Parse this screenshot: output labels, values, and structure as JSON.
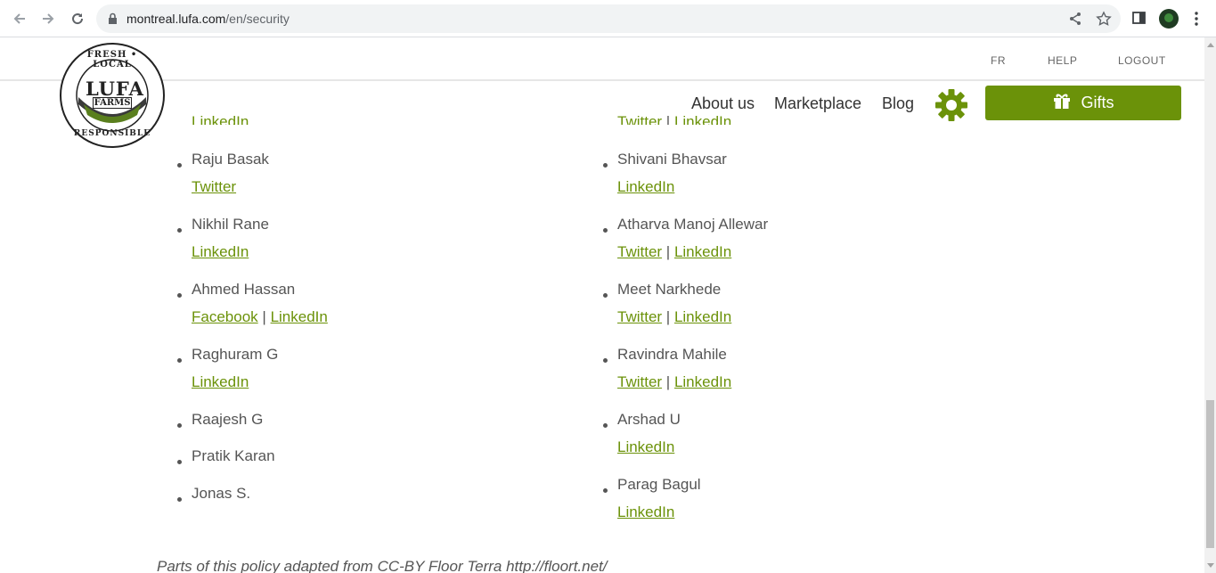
{
  "browser": {
    "url_host": "montreal.lufa.com",
    "url_path": "/en/security"
  },
  "header": {
    "util_links": [
      "FR",
      "HELP",
      "LOGOUT"
    ],
    "nav": [
      "About us",
      "Marketplace",
      "Blog"
    ],
    "gifts_label": "Gifts",
    "logo_text": {
      "top": "FRESH • LOCAL",
      "middle": "LUFA",
      "sub": "FARMS",
      "bottom": "RESPONSIBLE"
    }
  },
  "partial_links": {
    "left": "LinkedIn",
    "right_a": "Twitter",
    "right_sep": "|",
    "right_b": "LinkedIn"
  },
  "left_column": [
    {
      "name": "Raju Basak",
      "links": [
        "Twitter"
      ]
    },
    {
      "name": "Nikhil Rane",
      "links": [
        "LinkedIn"
      ]
    },
    {
      "name": "Ahmed Hassan",
      "links": [
        "Facebook",
        "LinkedIn"
      ]
    },
    {
      "name": "Raghuram G",
      "links": [
        "LinkedIn"
      ]
    },
    {
      "name": "Raajesh G",
      "links": []
    },
    {
      "name": "Pratik Karan",
      "links": []
    },
    {
      "name": "Jonas S.",
      "links": []
    }
  ],
  "right_column": [
    {
      "name": "Shivani Bhavsar",
      "links": [
        "LinkedIn"
      ]
    },
    {
      "name": "Atharva Manoj Allewar",
      "links": [
        "Twitter",
        "LinkedIn"
      ]
    },
    {
      "name": "Meet Narkhede",
      "links": [
        "Twitter",
        "LinkedIn"
      ]
    },
    {
      "name": "Ravindra Mahile",
      "links": [
        "Twitter",
        "LinkedIn"
      ]
    },
    {
      "name": "Arshad U",
      "links": [
        "LinkedIn"
      ]
    },
    {
      "name": "Parag Bagul",
      "links": [
        "LinkedIn"
      ]
    }
  ],
  "link_separator": "|",
  "footer_note": "Parts of this policy adapted from CC-BY Floor Terra http://floort.net/",
  "colors": {
    "accent": "#6b9209",
    "text": "#555555"
  }
}
